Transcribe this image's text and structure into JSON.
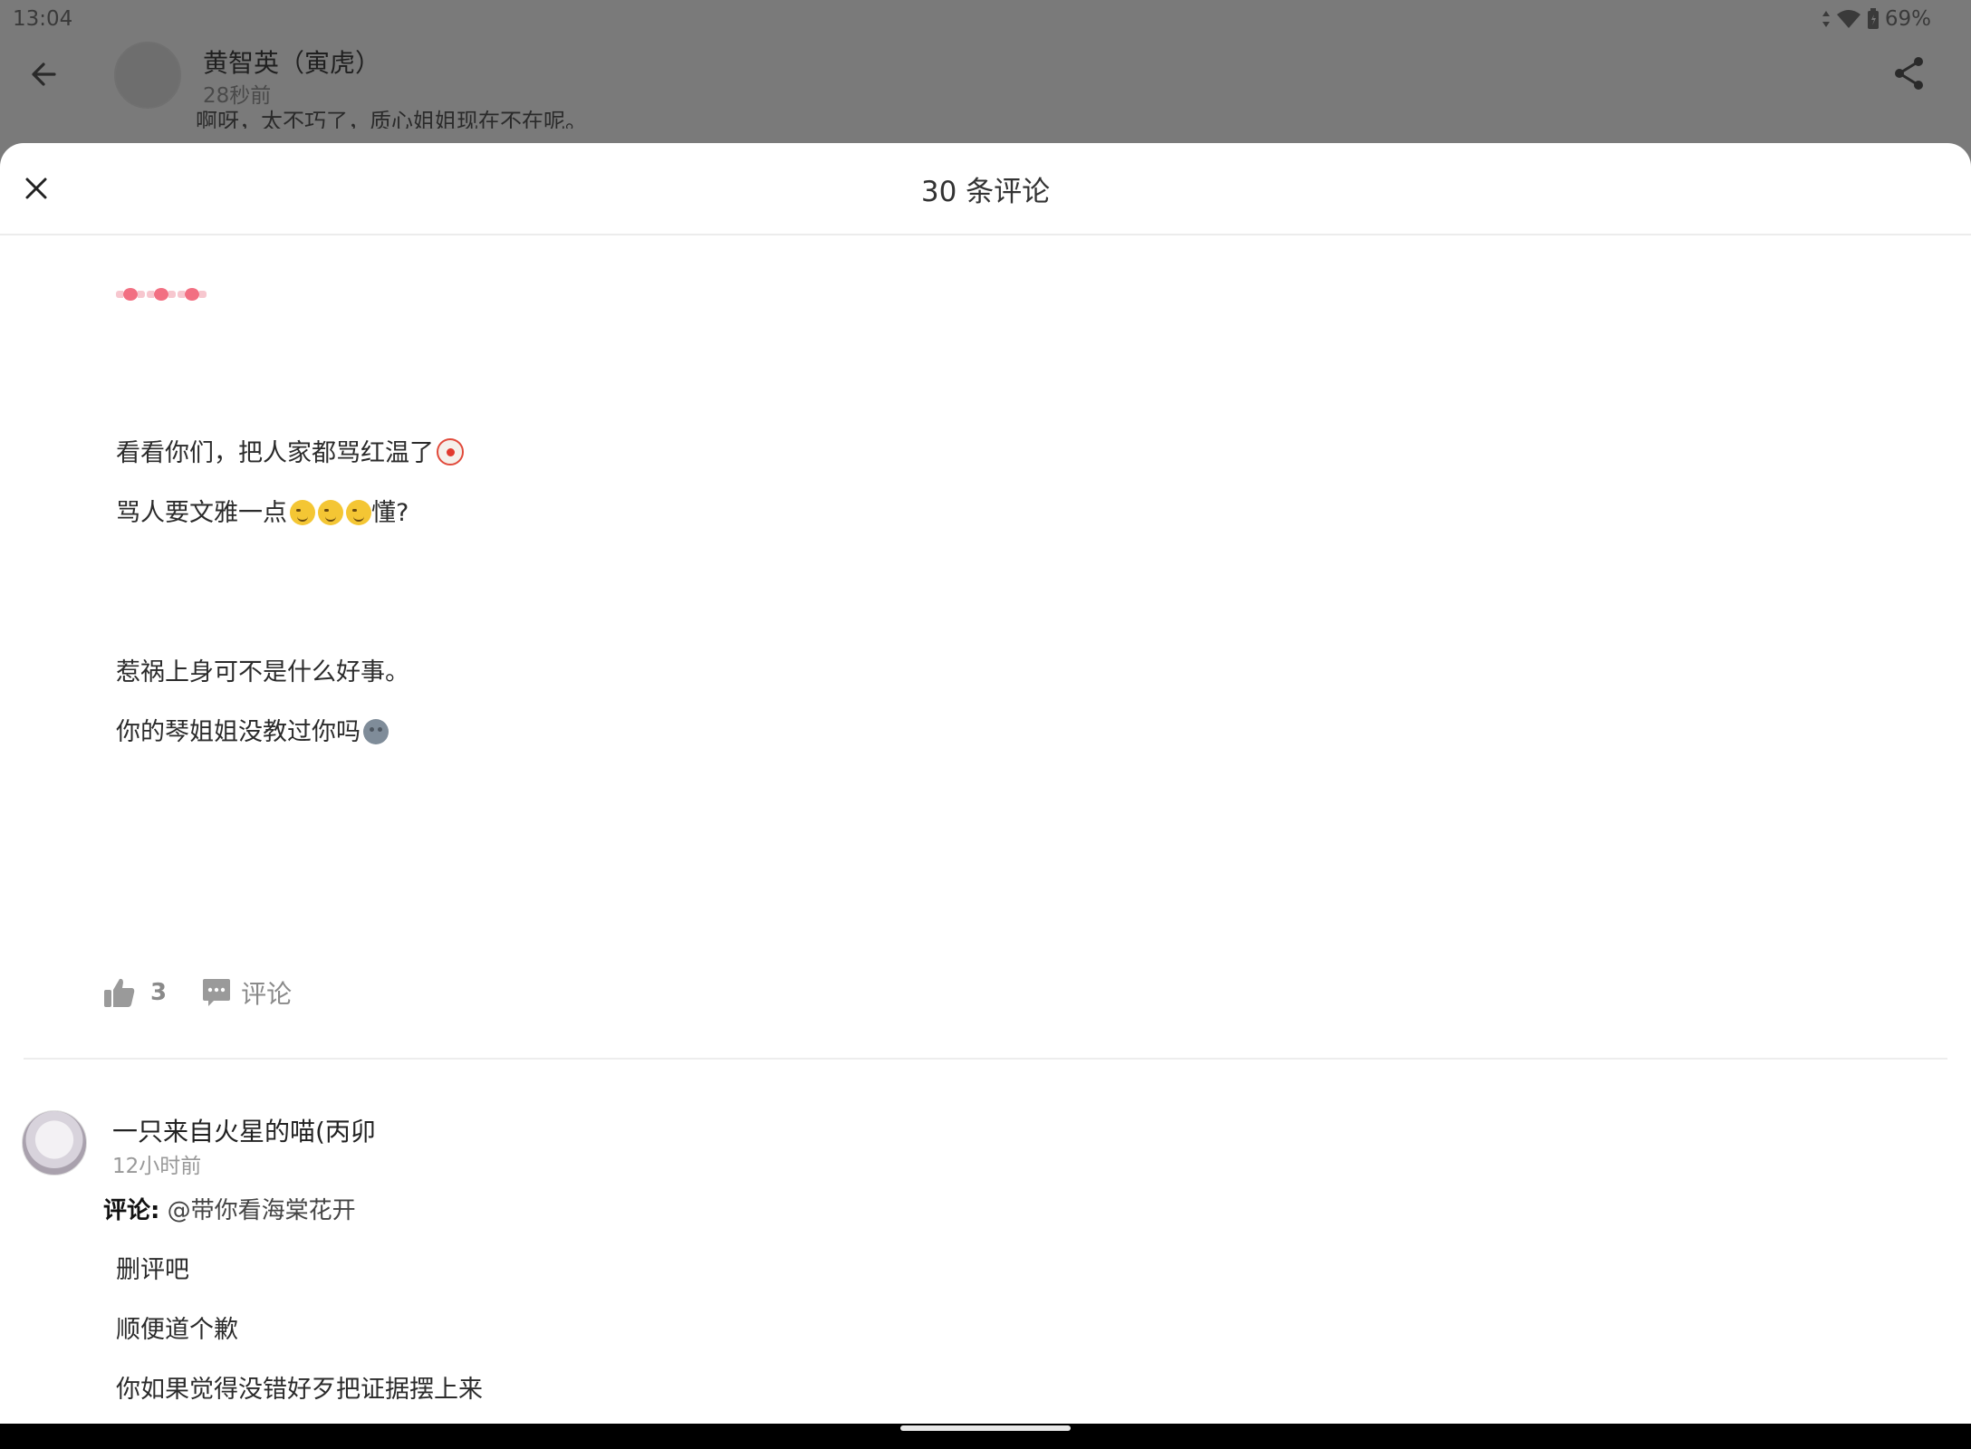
{
  "status_bar": {
    "time": "13:04",
    "battery": "69%",
    "icons": [
      "data-arrows-icon",
      "wifi-icon",
      "battery-icon"
    ]
  },
  "background_post": {
    "author": "黄智英（寅虎）",
    "time": "28秒前",
    "excerpt": "啊呀，太不巧了，质心姐姐现在不在呢。"
  },
  "sheet": {
    "title": "30 条评论"
  },
  "comment": {
    "paragraphs": [
      "看看你们，把人家都骂红温了",
      "骂人要文雅一点",
      "懂?",
      "惹祸上身可不是什么好事。",
      "你的琴姐姐没教过你吗"
    ],
    "likes": "3",
    "comment_label": "评论"
  },
  "reply": {
    "name": "一只来自火星的喵(丙卯",
    "time": "12小时前",
    "label": "评论:",
    "mention": "@带你看海棠花开",
    "lines": [
      "删评吧",
      "顺便道个歉",
      "你如果觉得没错好歹把证据摆上来"
    ]
  },
  "colors": {
    "overlay_dim": "#7a7a7a",
    "sheet_bg": "#ffffff",
    "muted_text": "#8a8a8a",
    "divider": "#ededed"
  }
}
